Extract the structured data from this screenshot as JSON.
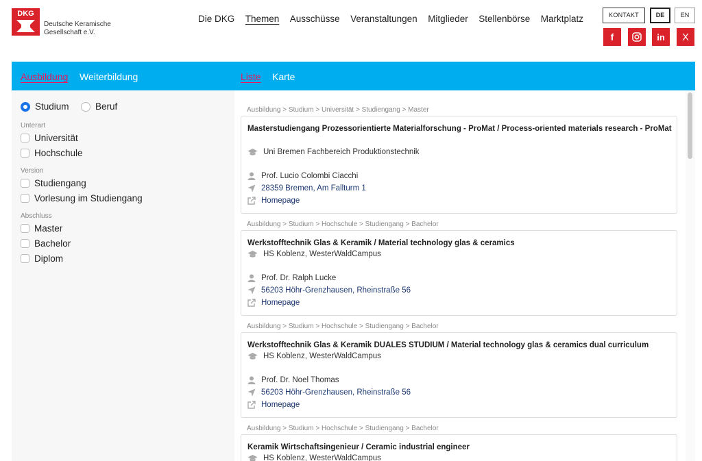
{
  "header": {
    "logo_text": "DKG",
    "org_line1": "Deutsche Keramische",
    "org_line2": "Gesellschaft e.V.",
    "nav": [
      "Die DKG",
      "Themen",
      "Ausschüsse",
      "Veranstaltungen",
      "Mitglieder",
      "Stellenbörse",
      "Marktplatz"
    ],
    "nav_active": "Themen",
    "kontakt": "KONTAKT",
    "lang_de": "DE",
    "lang_en": "EN",
    "social": [
      {
        "icon": "facebook-icon",
        "glyph": "f"
      },
      {
        "icon": "instagram-icon",
        "glyph": "◎"
      },
      {
        "icon": "linkedin-icon",
        "glyph": "in"
      },
      {
        "icon": "x-icon",
        "glyph": "X"
      }
    ],
    "brand_color": "#d9222a"
  },
  "tabs": {
    "left": [
      "Ausbildung",
      "Weiterbildung"
    ],
    "right": [
      "Liste",
      "Karte"
    ],
    "active_left": "Ausbildung",
    "active_right": "Liste",
    "bar_color": "#00aeef",
    "active_color": "#e8175d"
  },
  "filters": {
    "radios": [
      {
        "label": "Studium",
        "checked": true
      },
      {
        "label": "Beruf",
        "checked": false
      }
    ],
    "groups": [
      {
        "label": "Unterart",
        "options": [
          "Universität",
          "Hochschule"
        ]
      },
      {
        "label": "Version",
        "options": [
          "Studiengang",
          "Vorlesung im Studiengang"
        ]
      },
      {
        "label": "Abschluss",
        "options": [
          "Master",
          "Bachelor",
          "Diplom"
        ]
      }
    ]
  },
  "results": [
    {
      "breadcrumb": "Ausbildung > Studium > Universität > Studiengang > Master",
      "title": "Masterstudiengang Prozessorientierte Materialforschung - ProMat / Process-oriented materials research - ProMat",
      "institution": "Uni Bremen Fachbereich Produktionstechnik",
      "person": "Prof. Lucio Colombi Ciacchi",
      "address": "28359 Bremen, Am Fallturm 1",
      "homepage": "Homepage"
    },
    {
      "breadcrumb": "Ausbildung > Studium > Hochschule > Studiengang > Bachelor",
      "title": "Werkstofftechnik Glas & Keramik / Material technology glas & ceramics",
      "institution": "HS Koblenz, WesterWaldCampus",
      "person": "Prof. Dr. Ralph Lucke",
      "address": "56203 Höhr-Grenzhausen, Rheinstraße 56",
      "homepage": "Homepage"
    },
    {
      "breadcrumb": "Ausbildung > Studium > Hochschule > Studiengang > Bachelor",
      "title": "Werkstofftechnik Glas & Keramik DUALES STUDIUM / Material technology glas & ceramics dual curriculum",
      "institution": "HS Koblenz, WesterWaldCampus",
      "person": "Prof. Dr. Noel Thomas",
      "address": "56203 Höhr-Grenzhausen, Rheinstraße 56",
      "homepage": "Homepage"
    },
    {
      "breadcrumb": "Ausbildung > Studium > Hochschule > Studiengang > Bachelor",
      "title": "Keramik Wirtschaftsingenieur / Ceramic industrial engineer",
      "institution": "HS Koblenz, WesterWaldCampus",
      "person": "",
      "address": "",
      "homepage": ""
    }
  ]
}
